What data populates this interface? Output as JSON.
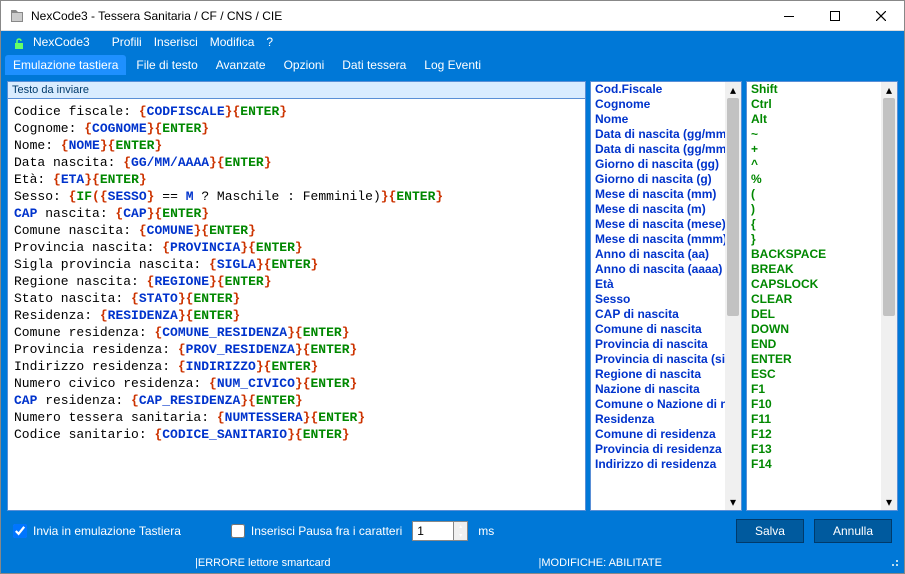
{
  "window": {
    "title": "NexCode3 - Tessera Sanitaria / CF / CNS / CIE"
  },
  "menu": {
    "app": "NexCode3",
    "items": [
      "Profili",
      "Inserisci",
      "Modifica",
      "?"
    ]
  },
  "tabs": [
    {
      "label": "Emulazione tastiera",
      "active": true
    },
    {
      "label": "File di testo",
      "active": false
    },
    {
      "label": "Avanzate",
      "active": false
    },
    {
      "label": "Opzioni",
      "active": false
    },
    {
      "label": "Dati tessera",
      "active": false
    },
    {
      "label": "Log Eventi",
      "active": false
    }
  ],
  "editor": {
    "header": "Testo da inviare",
    "lines": [
      [
        {
          "t": "Codice fiscale: ",
          "c": "black"
        },
        {
          "t": "{",
          "c": "red"
        },
        {
          "t": "CODFISCALE",
          "c": "blue"
        },
        {
          "t": "}",
          "c": "red"
        },
        {
          "t": "{",
          "c": "red"
        },
        {
          "t": "ENTER",
          "c": "green"
        },
        {
          "t": "}",
          "c": "red"
        }
      ],
      [
        {
          "t": "Cognome: ",
          "c": "black"
        },
        {
          "t": "{",
          "c": "red"
        },
        {
          "t": "COGNOME",
          "c": "blue"
        },
        {
          "t": "}",
          "c": "red"
        },
        {
          "t": "{",
          "c": "red"
        },
        {
          "t": "ENTER",
          "c": "green"
        },
        {
          "t": "}",
          "c": "red"
        }
      ],
      [
        {
          "t": "Nome: ",
          "c": "black"
        },
        {
          "t": "{",
          "c": "red"
        },
        {
          "t": "NOME",
          "c": "blue"
        },
        {
          "t": "}",
          "c": "red"
        },
        {
          "t": "{",
          "c": "red"
        },
        {
          "t": "ENTER",
          "c": "green"
        },
        {
          "t": "}",
          "c": "red"
        }
      ],
      [
        {
          "t": "Data nascita: ",
          "c": "black"
        },
        {
          "t": "{",
          "c": "red"
        },
        {
          "t": "GG/MM/AAAA",
          "c": "blue"
        },
        {
          "t": "}",
          "c": "red"
        },
        {
          "t": "{",
          "c": "red"
        },
        {
          "t": "ENTER",
          "c": "green"
        },
        {
          "t": "}",
          "c": "red"
        }
      ],
      [
        {
          "t": "Età: ",
          "c": "black"
        },
        {
          "t": "{",
          "c": "red"
        },
        {
          "t": "ETA",
          "c": "blue"
        },
        {
          "t": "}",
          "c": "red"
        },
        {
          "t": "{",
          "c": "red"
        },
        {
          "t": "ENTER",
          "c": "green"
        },
        {
          "t": "}",
          "c": "red"
        }
      ],
      [
        {
          "t": "Sesso: ",
          "c": "black"
        },
        {
          "t": "{",
          "c": "red"
        },
        {
          "t": "IF",
          "c": "green"
        },
        {
          "t": "(",
          "c": "red"
        },
        {
          "t": "{",
          "c": "red"
        },
        {
          "t": "SESSO",
          "c": "blue"
        },
        {
          "t": "}",
          "c": "red"
        },
        {
          "t": " == ",
          "c": "black"
        },
        {
          "t": "M",
          "c": "blue"
        },
        {
          "t": " ? Maschile : Femminile)",
          "c": "black"
        },
        {
          "t": "}",
          "c": "red"
        },
        {
          "t": "{",
          "c": "red"
        },
        {
          "t": "ENTER",
          "c": "green"
        },
        {
          "t": "}",
          "c": "red"
        }
      ],
      [
        {
          "t": "CAP",
          "c": "blue"
        },
        {
          "t": " nascita: ",
          "c": "black"
        },
        {
          "t": "{",
          "c": "red"
        },
        {
          "t": "CAP",
          "c": "blue"
        },
        {
          "t": "}",
          "c": "red"
        },
        {
          "t": "{",
          "c": "red"
        },
        {
          "t": "ENTER",
          "c": "green"
        },
        {
          "t": "}",
          "c": "red"
        }
      ],
      [
        {
          "t": "Comune nascita: ",
          "c": "black"
        },
        {
          "t": "{",
          "c": "red"
        },
        {
          "t": "COMUNE",
          "c": "blue"
        },
        {
          "t": "}",
          "c": "red"
        },
        {
          "t": "{",
          "c": "red"
        },
        {
          "t": "ENTER",
          "c": "green"
        },
        {
          "t": "}",
          "c": "red"
        }
      ],
      [
        {
          "t": "Provincia nascita: ",
          "c": "black"
        },
        {
          "t": "{",
          "c": "red"
        },
        {
          "t": "PROVINCIA",
          "c": "blue"
        },
        {
          "t": "}",
          "c": "red"
        },
        {
          "t": "{",
          "c": "red"
        },
        {
          "t": "ENTER",
          "c": "green"
        },
        {
          "t": "}",
          "c": "red"
        }
      ],
      [
        {
          "t": "Sigla provincia nascita: ",
          "c": "black"
        },
        {
          "t": "{",
          "c": "red"
        },
        {
          "t": "SIGLA",
          "c": "blue"
        },
        {
          "t": "}",
          "c": "red"
        },
        {
          "t": "{",
          "c": "red"
        },
        {
          "t": "ENTER",
          "c": "green"
        },
        {
          "t": "}",
          "c": "red"
        }
      ],
      [
        {
          "t": "Regione nascita: ",
          "c": "black"
        },
        {
          "t": "{",
          "c": "red"
        },
        {
          "t": "REGIONE",
          "c": "blue"
        },
        {
          "t": "}",
          "c": "red"
        },
        {
          "t": "{",
          "c": "red"
        },
        {
          "t": "ENTER",
          "c": "green"
        },
        {
          "t": "}",
          "c": "red"
        }
      ],
      [
        {
          "t": "Stato nascita: ",
          "c": "black"
        },
        {
          "t": "{",
          "c": "red"
        },
        {
          "t": "STATO",
          "c": "blue"
        },
        {
          "t": "}",
          "c": "red"
        },
        {
          "t": "{",
          "c": "red"
        },
        {
          "t": "ENTER",
          "c": "green"
        },
        {
          "t": "}",
          "c": "red"
        }
      ],
      [
        {
          "t": "Residenza: ",
          "c": "black"
        },
        {
          "t": "{",
          "c": "red"
        },
        {
          "t": "RESIDENZA",
          "c": "blue"
        },
        {
          "t": "}",
          "c": "red"
        },
        {
          "t": "{",
          "c": "red"
        },
        {
          "t": "ENTER",
          "c": "green"
        },
        {
          "t": "}",
          "c": "red"
        }
      ],
      [
        {
          "t": "Comune residenza: ",
          "c": "black"
        },
        {
          "t": "{",
          "c": "red"
        },
        {
          "t": "COMUNE_RESIDENZA",
          "c": "blue"
        },
        {
          "t": "}",
          "c": "red"
        },
        {
          "t": "{",
          "c": "red"
        },
        {
          "t": "ENTER",
          "c": "green"
        },
        {
          "t": "}",
          "c": "red"
        }
      ],
      [
        {
          "t": "Provincia residenza: ",
          "c": "black"
        },
        {
          "t": "{",
          "c": "red"
        },
        {
          "t": "PROV_RESIDENZA",
          "c": "blue"
        },
        {
          "t": "}",
          "c": "red"
        },
        {
          "t": "{",
          "c": "red"
        },
        {
          "t": "ENTER",
          "c": "green"
        },
        {
          "t": "}",
          "c": "red"
        }
      ],
      [
        {
          "t": "Indirizzo residenza: ",
          "c": "black"
        },
        {
          "t": "{",
          "c": "red"
        },
        {
          "t": "INDIRIZZO",
          "c": "blue"
        },
        {
          "t": "}",
          "c": "red"
        },
        {
          "t": "{",
          "c": "red"
        },
        {
          "t": "ENTER",
          "c": "green"
        },
        {
          "t": "}",
          "c": "red"
        }
      ],
      [
        {
          "t": "Numero civico residenza: ",
          "c": "black"
        },
        {
          "t": "{",
          "c": "red"
        },
        {
          "t": "NUM_CIVICO",
          "c": "blue"
        },
        {
          "t": "}",
          "c": "red"
        },
        {
          "t": "{",
          "c": "red"
        },
        {
          "t": "ENTER",
          "c": "green"
        },
        {
          "t": "}",
          "c": "red"
        }
      ],
      [
        {
          "t": "CAP",
          "c": "blue"
        },
        {
          "t": " residenza: ",
          "c": "black"
        },
        {
          "t": "{",
          "c": "red"
        },
        {
          "t": "CAP_RESIDENZA",
          "c": "blue"
        },
        {
          "t": "}",
          "c": "red"
        },
        {
          "t": "{",
          "c": "red"
        },
        {
          "t": "ENTER",
          "c": "green"
        },
        {
          "t": "}",
          "c": "red"
        }
      ],
      [
        {
          "t": "Numero tessera sanitaria: ",
          "c": "black"
        },
        {
          "t": "{",
          "c": "red"
        },
        {
          "t": "NUMTESSERA",
          "c": "blue"
        },
        {
          "t": "}",
          "c": "red"
        },
        {
          "t": "{",
          "c": "red"
        },
        {
          "t": "ENTER",
          "c": "green"
        },
        {
          "t": "}",
          "c": "red"
        }
      ],
      [
        {
          "t": "Codice sanitario: ",
          "c": "black"
        },
        {
          "t": "{",
          "c": "red"
        },
        {
          "t": "CODICE_SANITARIO",
          "c": "blue"
        },
        {
          "t": "}",
          "c": "red"
        },
        {
          "t": "{",
          "c": "red"
        },
        {
          "t": "ENTER",
          "c": "green"
        },
        {
          "t": "}",
          "c": "red"
        }
      ]
    ]
  },
  "fields_list": [
    "Cod.Fiscale",
    "Cognome",
    "Nome",
    "Data di nascita (gg/mm/",
    "Data di nascita (gg/mm/",
    "Giorno di nascita (gg)",
    "Giorno di nascita (g)",
    "Mese di nascita (mm)",
    "Mese di nascita (m)",
    "Mese di nascita (mese)",
    "Mese di nascita (mmm)",
    "Anno di nascita (aa)",
    "Anno di nascita (aaaa)",
    "Età",
    "Sesso",
    "CAP di nascita",
    "Comune di nascita",
    "Provincia di nascita",
    "Provincia di nascita (sigl",
    "Regione di nascita",
    "Nazione di nascita",
    "Comune o Nazione di nas",
    "Residenza",
    "Comune di residenza",
    "Provincia di residenza",
    "Indirizzo di residenza"
  ],
  "keys_list": [
    "Shift",
    "Ctrl",
    "Alt",
    "~",
    "+",
    "^",
    "%",
    "(",
    ")",
    "{",
    "}",
    "BACKSPACE",
    "BREAK",
    "CAPSLOCK",
    "CLEAR",
    "DEL",
    "DOWN",
    "END",
    "ENTER",
    "ESC",
    "F1",
    "F10",
    "F11",
    "F12",
    "F13",
    "F14"
  ],
  "bottom": {
    "chk1_label": "Invia in emulazione Tastiera",
    "chk1_checked": true,
    "chk2_label": "Inserisci Pausa fra i caratteri",
    "chk2_checked": false,
    "ms_value": "1",
    "ms_unit": "ms",
    "save": "Salva",
    "cancel": "Annulla"
  },
  "status": {
    "left": "|ERRORE lettore smartcard",
    "right": "|MODIFICHE: ABILITATE"
  }
}
